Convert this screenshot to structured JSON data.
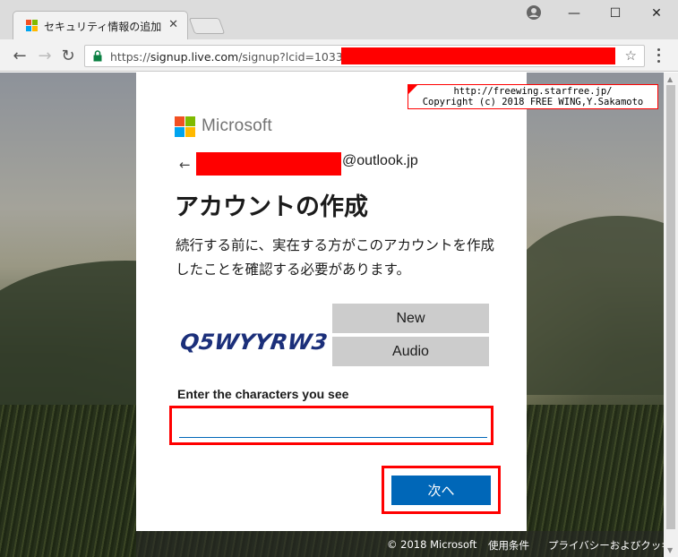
{
  "browser": {
    "tab_title": "セキュリティ情報の追加",
    "tab_close": "✕",
    "url_scheme": "https://",
    "url_host": "signup.live.com",
    "url_rest": "/signup?lcid=1033",
    "window": {
      "minimize": "—",
      "maximize": "☐",
      "close": "✕"
    },
    "nav": {
      "back": "←",
      "forward": "→",
      "reload": "↻"
    },
    "bookmark": "☆"
  },
  "card": {
    "brand": "Microsoft",
    "back_arrow": "←",
    "email_domain": "@outlook.jp",
    "title": "アカウントの作成",
    "description": "続行する前に、実在する方がこのアカウントを作成したことを確認する必要があります。",
    "captcha_text": "Q5WYYRW3",
    "new_button": "New",
    "audio_button": "Audio",
    "input_label": "Enter the characters you see",
    "input_value": "",
    "next_button": "次へ"
  },
  "footer": {
    "copyright": "© 2018 Microsoft",
    "terms": "使用条件",
    "privacy": "プライバシーおよびクッキー"
  },
  "watermark": {
    "line1": "http://freewing.starfree.jp/",
    "line2": "Copyright (c) 2018 FREE WING,Y.Sakamoto"
  },
  "colors": {
    "accent": "#0067b8",
    "redaction": "#ff0000",
    "captcha_ink": "#1b2f7a"
  }
}
